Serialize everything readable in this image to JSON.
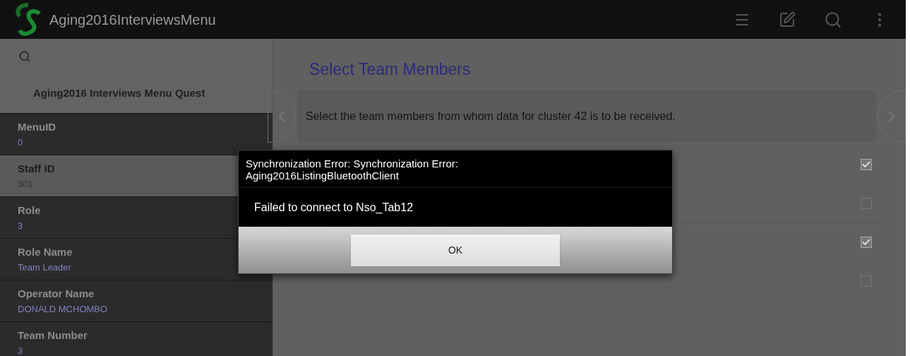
{
  "app_bar": {
    "title": "Aging2016InterviewsMenu"
  },
  "sidebar": {
    "title": "Aging2016 Interviews Menu Quest",
    "items": [
      {
        "label": "MenuID",
        "value": "0",
        "selected": false
      },
      {
        "label": "Staff ID",
        "value": "301",
        "selected": true
      },
      {
        "label": "Role",
        "value": "3",
        "selected": false
      },
      {
        "label": "Role Name",
        "value": "Team Leader",
        "selected": false
      },
      {
        "label": "Operator Name",
        "value": "DONALD MCHOMBO",
        "selected": false
      },
      {
        "label": "Team Number",
        "value": "3",
        "selected": false
      }
    ]
  },
  "question": {
    "title": "Select Team Members",
    "text": "Select the team members from whom data for cluster 42 is to be received.",
    "options": [
      {
        "checked": true
      },
      {
        "checked": false
      },
      {
        "checked": true
      },
      {
        "checked": false
      }
    ]
  },
  "dialog": {
    "title": "Synchronization Error: Synchronization Error: Aging2016ListingBluetoothClient",
    "message": "Failed to connect to Nso_Tab12",
    "button": "OK"
  }
}
